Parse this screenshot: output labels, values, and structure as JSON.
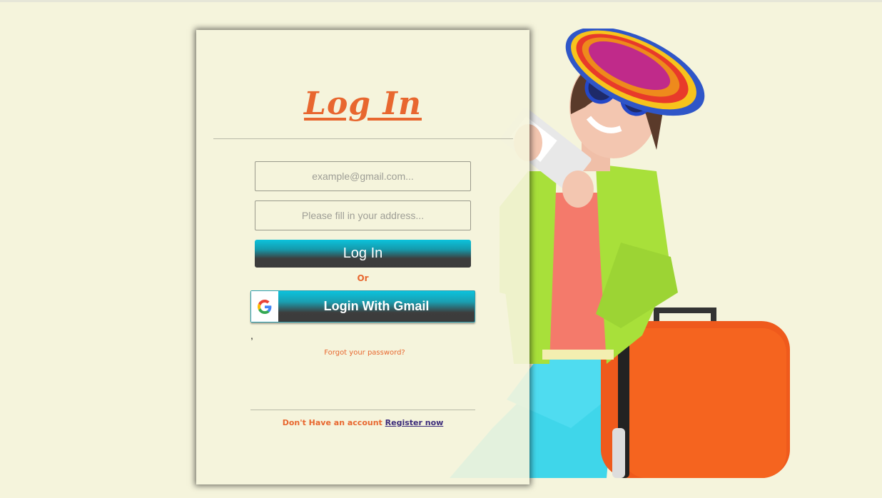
{
  "login": {
    "title": "Log In",
    "email_placeholder": "example@gmail.com...",
    "address_placeholder": "Please fill in your address...",
    "login_button": "Log In",
    "or_text": "Or",
    "gmail_button": "Login With Gmail",
    "stray_text": ",",
    "forgot_password": "Forgot your password?",
    "register_prompt": "Don't Have an account",
    "register_link": "Register now"
  },
  "icons": {
    "google": "google-g-icon"
  },
  "colors": {
    "background": "#f5f4dc",
    "accent": "#e8672f",
    "button_top": "#0cc2dc",
    "button_bottom": "#3b3b3b",
    "link": "#3b2a7a"
  }
}
